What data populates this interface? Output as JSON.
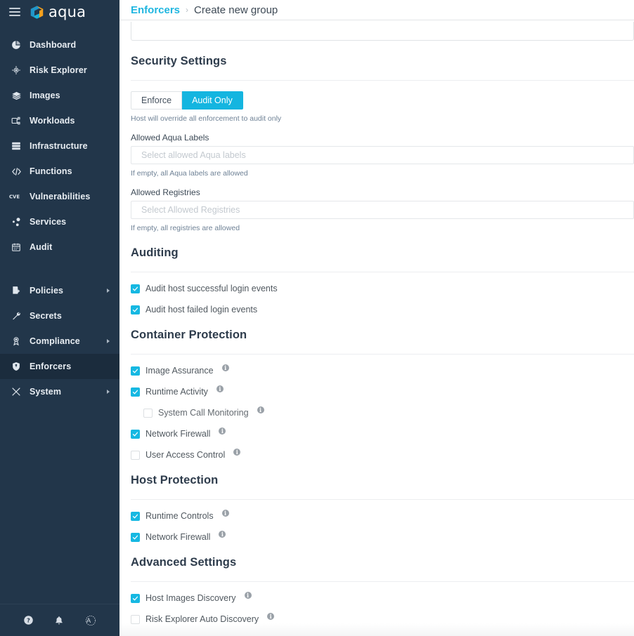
{
  "sidebar": {
    "brand": "aqua",
    "items": [
      {
        "label": "Dashboard",
        "icon": "pie-chart-icon",
        "caret": false,
        "active": false
      },
      {
        "label": "Risk Explorer",
        "icon": "target-icon",
        "caret": false,
        "active": false
      },
      {
        "label": "Images",
        "icon": "layers-icon",
        "caret": false,
        "active": false
      },
      {
        "label": "Workloads",
        "icon": "workloads-icon",
        "caret": false,
        "active": false
      },
      {
        "label": "Infrastructure",
        "icon": "server-icon",
        "caret": false,
        "active": false
      },
      {
        "label": "Functions",
        "icon": "code-icon",
        "caret": false,
        "active": false
      },
      {
        "label": "Vulnerabilities",
        "icon": "cve-icon",
        "caret": false,
        "active": false
      },
      {
        "label": "Services",
        "icon": "services-icon",
        "caret": false,
        "active": false
      },
      {
        "label": "Audit",
        "icon": "calendar-icon",
        "caret": false,
        "active": false
      },
      {
        "label": "Policies",
        "icon": "policy-icon",
        "caret": true,
        "active": false
      },
      {
        "label": "Secrets",
        "icon": "wrench-icon",
        "caret": false,
        "active": false
      },
      {
        "label": "Compliance",
        "icon": "badge-icon",
        "caret": true,
        "active": false
      },
      {
        "label": "Enforcers",
        "icon": "shield-icon",
        "caret": false,
        "active": true
      },
      {
        "label": "System",
        "icon": "tools-icon",
        "caret": true,
        "active": false
      }
    ],
    "footer": [
      {
        "name": "help-icon",
        "glyph": "?"
      },
      {
        "name": "notifications-bell-icon",
        "glyph": "bell"
      },
      {
        "name": "user-avatar",
        "glyph": "A"
      }
    ]
  },
  "breadcrumb": {
    "root": "Enforcers",
    "separator": "›",
    "current": "Create new group"
  },
  "sections": {
    "security_settings": {
      "title": "Security Settings",
      "mode_toggle": {
        "options": [
          "Enforce",
          "Audit Only"
        ],
        "selected": "Audit Only"
      },
      "mode_hint": "Host will override all enforcement to audit only",
      "aqua_labels": {
        "label": "Allowed Aqua Labels",
        "placeholder": "Select allowed Aqua labels",
        "value": "",
        "hint": "If empty, all Aqua labels are allowed"
      },
      "registries": {
        "label": "Allowed Registries",
        "placeholder": "Select Allowed Registries",
        "value": "",
        "hint": "If empty, all registries are allowed"
      }
    },
    "auditing": {
      "title": "Auditing",
      "items": [
        {
          "label": "Audit host successful login events",
          "checked": true,
          "info": false,
          "indent": false
        },
        {
          "label": "Audit host failed login events",
          "checked": true,
          "info": false,
          "indent": false
        }
      ]
    },
    "container_protection": {
      "title": "Container Protection",
      "items": [
        {
          "label": "Image Assurance",
          "checked": true,
          "info": true,
          "indent": false
        },
        {
          "label": "Runtime Activity",
          "checked": true,
          "info": true,
          "indent": false
        },
        {
          "label": "System Call Monitoring",
          "checked": false,
          "info": true,
          "indent": true
        },
        {
          "label": "Network Firewall",
          "checked": true,
          "info": true,
          "indent": false
        },
        {
          "label": "User Access Control",
          "checked": false,
          "info": true,
          "indent": false
        }
      ]
    },
    "host_protection": {
      "title": "Host Protection",
      "items": [
        {
          "label": "Runtime Controls",
          "checked": true,
          "info": true,
          "indent": false
        },
        {
          "label": "Network Firewall",
          "checked": true,
          "info": true,
          "indent": false
        }
      ]
    },
    "advanced_settings": {
      "title": "Advanced Settings",
      "items": [
        {
          "label": "Host Images Discovery",
          "checked": true,
          "info": true,
          "indent": false
        },
        {
          "label": "Risk Explorer Auto Discovery",
          "checked": false,
          "info": true,
          "indent": false
        }
      ]
    }
  },
  "colors": {
    "accent": "#14b5e0",
    "sidebar_bg": "#22364a",
    "sidebar_active": "#1b2c3d",
    "heading": "#2e3c4c",
    "hint": "#6f8296"
  }
}
